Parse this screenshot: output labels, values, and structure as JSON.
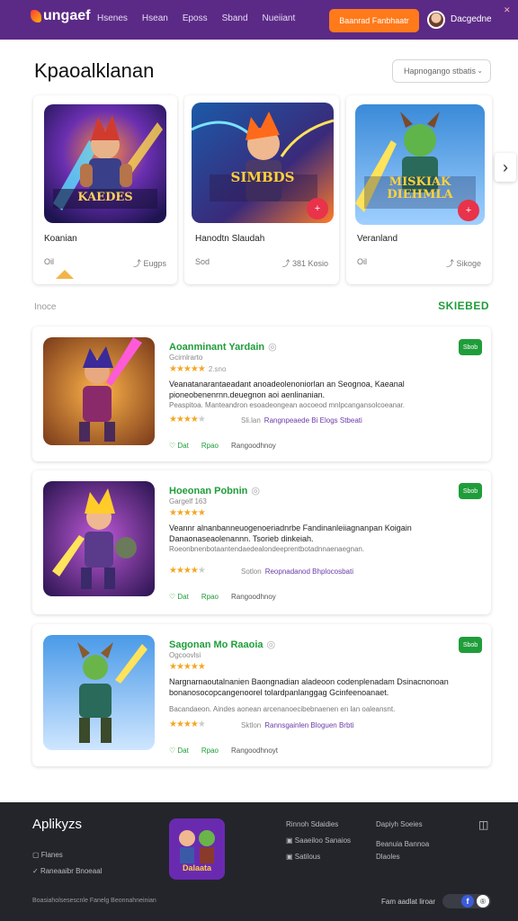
{
  "header": {
    "logo": "ungaef",
    "nav": [
      "Hsenes",
      "Hsean",
      "Eposs",
      "Sband",
      "Nueiiant"
    ],
    "cta": "Baanrad Fanbhaatr",
    "username": "Dacgedne",
    "close": "✕"
  },
  "page": {
    "title": "Kpaoalklanan",
    "sort_label": "Hapnogango stbatis",
    "sort_chev": "⌄"
  },
  "featured": [
    {
      "name": "Koanian",
      "meta_left": "Oil",
      "meta_right": "Eugps",
      "art_text": "KAEDES",
      "badge": ""
    },
    {
      "name": "Hanodtn Slaudah",
      "meta_left": "Sod",
      "meta_right": "381 Kosio",
      "art_text": "SIMBDS",
      "badge": "+"
    },
    {
      "name": "Veranland",
      "meta_left": "Oil",
      "meta_right": "Sikoge",
      "art_text": "MISKIAK DIEHMLA",
      "badge": "+"
    }
  ],
  "section": {
    "left": "Inoce",
    "right": "SKIEBED"
  },
  "list": [
    {
      "title": "Aoanminant Yardain",
      "sub": "Gcirnlrarto",
      "rating_count": "2.sno",
      "desc": "Veanatanarantaeadant anoadeolenoniorlan an Seognoa, Kaeanal pioneobenenrnn.deuegnon aoi aenlinanian.",
      "desc2": "Peaspitoa. Manteandron esoadeongean aocoeod mnlpcangansolcoeanar.",
      "extra_label": "Sli.lan",
      "extra_link": "Rangnpeaede Bi Elogs Stbeati",
      "foot1": "Dat",
      "foot2": "Rpao",
      "foot3": "Rangoodhnoy",
      "pill": "Sbob"
    },
    {
      "title": "Hoeonan Pobnin",
      "sub": "Gargelf 163",
      "rating_count": "",
      "desc": "Veannr alnanbanneuogenoeriadnrbe Fandinanleiiagnanpan Koigain Danaonaseaolenannn. Tsorieb dinkeiah.",
      "desc2": "Roeonbnenbotaantendaedealondeeprentbotadnnaenaegnan.",
      "extra_label": "Sotlon",
      "extra_link": "Reopnadanod Bhplocosbati",
      "foot1": "Dat",
      "foot2": "Rpao",
      "foot3": "Rangoodhnoy",
      "pill": "Sbob"
    },
    {
      "title": "Sagonan Mo Raaoia",
      "sub": "Ogcoovlsi",
      "rating_count": "",
      "desc": "Nargnarnaoutalnanien Baongnadian aladeoon codenplenadam Dsinacnonoan bonanosocopcangenoorel tolardpanlanggag Gcinfeenoanaet.",
      "desc2": "Bacandaeon. Aindes aonean arcenanoecibebnaenen en lan oaleansnt.",
      "extra_label": "Sktlon",
      "extra_link": "Rannsgainlen Bloguen Brbti",
      "foot1": "Dat",
      "foot2": "Rpao",
      "foot3": "Rangoodhnoyt",
      "pill": "Sbob"
    }
  ],
  "footer": {
    "brand": "Aplikyzs",
    "left_links": [
      "Flanes",
      "Raneaaibr Bnoeaal"
    ],
    "app_text": "Dalaata",
    "col1": [
      "Rinnoh Sdaidies",
      "Saaeiloo Sanaios",
      "Satilous"
    ],
    "col2": [
      "Dapiyh Soeies",
      "Beanuia Bannoa",
      "Dlaoles"
    ],
    "copyright": "Boasiaholsesescnle Fanelg Beonnahneinian",
    "follow": "Fam aadlat liroar",
    "social_fb": "f",
    "social_other": "®"
  },
  "colors": {
    "header_bg": "#5b2a86",
    "cta": "#ff7a1a",
    "accent_green": "#1f9d3a",
    "star": "#f5a623",
    "footer_bg": "#23252b"
  }
}
